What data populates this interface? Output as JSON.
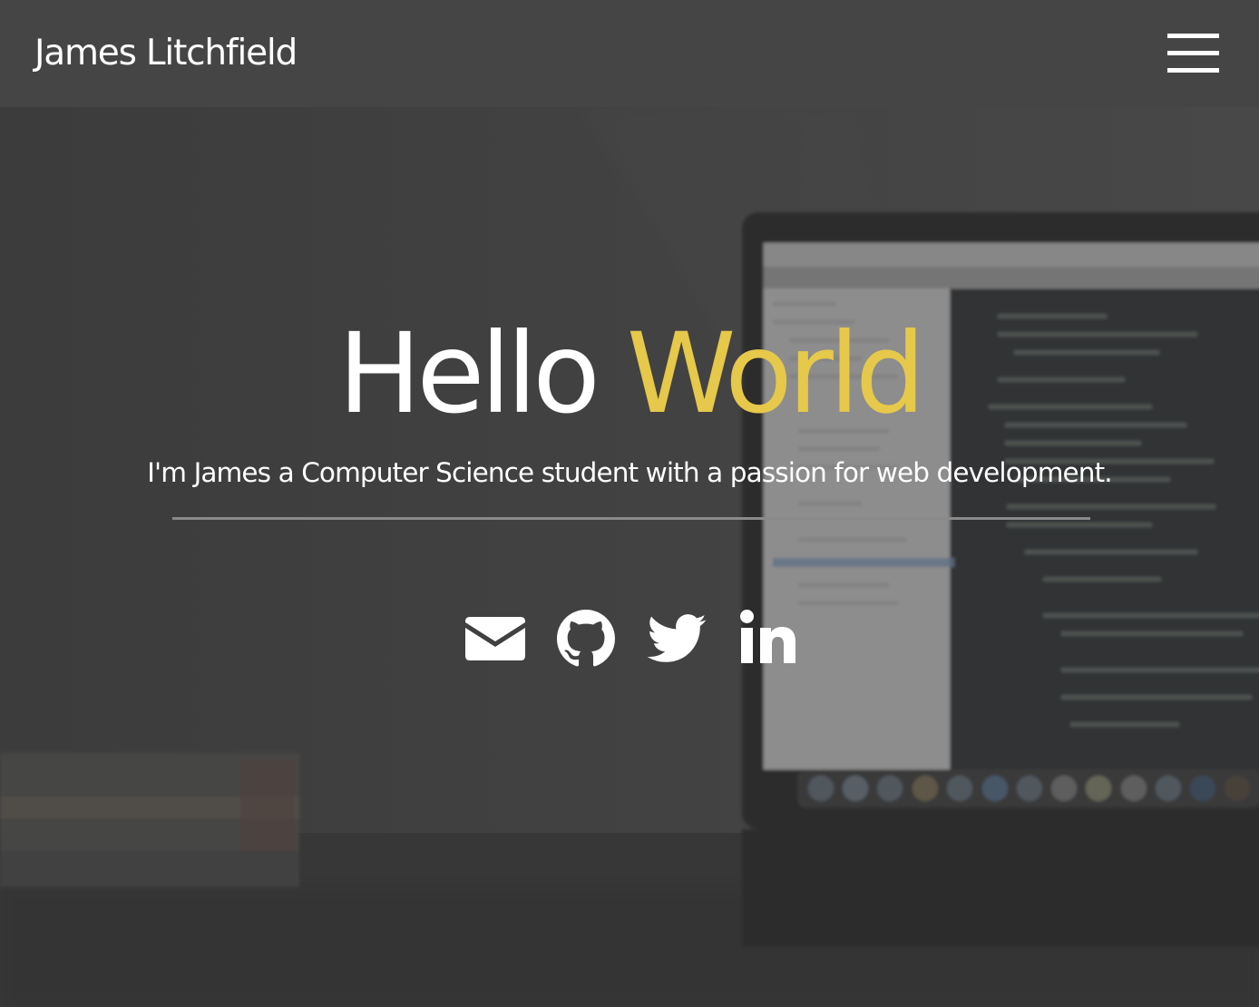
{
  "navbar": {
    "brand": "James Litchfield",
    "menu_icon": "hamburger-menu-icon"
  },
  "hero": {
    "background": "blurred-laptop-desk-photo",
    "headline": {
      "word1": "Hello",
      "word2": "World"
    },
    "tagline": "I'm James a Computer Science student with a passion for web development.",
    "social": [
      {
        "icon": "envelope-icon"
      },
      {
        "icon": "github-icon"
      },
      {
        "icon": "twitter-icon"
      },
      {
        "icon": "linkedin-icon"
      }
    ]
  },
  "colors": {
    "accent": "#e6c84a",
    "navbar": "#454545",
    "overlay": "#3a3a3a",
    "text": "#ffffff"
  }
}
